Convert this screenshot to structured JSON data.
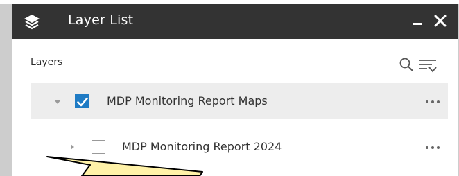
{
  "header": {
    "title": "Layer List",
    "icon": "layers-icon",
    "minimize_icon": "minimize-icon",
    "close_icon": "close-icon",
    "background": "#333333",
    "text_color": "#ffffff"
  },
  "toolbar": {
    "section_label": "Layers",
    "search_icon": "search-icon",
    "filter_icon": "filter-icon"
  },
  "layers": [
    {
      "label": "MDP Monitoring Report Maps",
      "checked": true,
      "expanded": true,
      "menu_icon": "more-options-icon"
    },
    {
      "label": "MDP Monitoring Report 2024",
      "checked": false,
      "expanded": false,
      "menu_icon": "more-options-icon"
    }
  ],
  "colors": {
    "accent": "#1f7bc4",
    "row_highlight": "#ededed",
    "callout_fill": "#fff2a8",
    "backdrop": "#cdcdcd"
  }
}
